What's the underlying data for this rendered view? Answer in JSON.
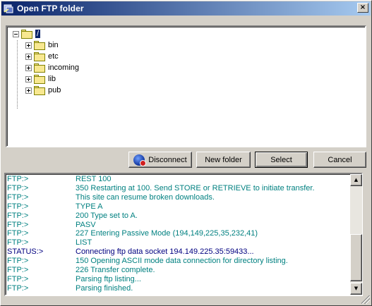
{
  "window": {
    "title": "Open FTP folder",
    "close_label": "×"
  },
  "tree": {
    "root": {
      "label": "/",
      "selected": true
    },
    "items": [
      {
        "label": "bin"
      },
      {
        "label": "etc"
      },
      {
        "label": "incoming"
      },
      {
        "label": "lib"
      },
      {
        "label": "pub"
      }
    ]
  },
  "buttons": {
    "disconnect": "Disconnect",
    "new_folder": "New folder",
    "select": "Select",
    "cancel": "Cancel"
  },
  "log": {
    "colors": {
      "ftp": "#008080",
      "status": "#000080"
    },
    "rows": [
      {
        "src": "FTP:>",
        "msg": "REST 100",
        "kind": "ftp"
      },
      {
        "src": "FTP:>",
        "msg": "350 Restarting at 100. Send STORE or RETRIEVE to initiate transfer.",
        "kind": "ftp"
      },
      {
        "src": "FTP:>",
        "msg": "This site can resume broken downloads.",
        "kind": "ftp"
      },
      {
        "src": "FTP:>",
        "msg": "TYPE A",
        "kind": "ftp"
      },
      {
        "src": "FTP:>",
        "msg": "200 Type set to A.",
        "kind": "ftp"
      },
      {
        "src": "FTP:>",
        "msg": "PASV",
        "kind": "ftp"
      },
      {
        "src": "FTP:>",
        "msg": "227 Entering Passive Mode (194,149,225,35,232,41)",
        "kind": "ftp"
      },
      {
        "src": "FTP:>",
        "msg": "LIST",
        "kind": "ftp"
      },
      {
        "src": "STATUS:>",
        "msg": "Connecting ftp data socket 194.149.225.35:59433...",
        "kind": "status"
      },
      {
        "src": "FTP:>",
        "msg": "150 Opening ASCII mode data connection for directory listing.",
        "kind": "ftp"
      },
      {
        "src": "FTP:>",
        "msg": "226 Transfer complete.",
        "kind": "ftp"
      },
      {
        "src": "FTP:>",
        "msg": "Parsing ftp listing...",
        "kind": "ftp"
      },
      {
        "src": "FTP:>",
        "msg": "Parsing finished.",
        "kind": "ftp"
      }
    ]
  },
  "scrollbar": {
    "up_icon": "▲",
    "down_icon": "▼"
  }
}
